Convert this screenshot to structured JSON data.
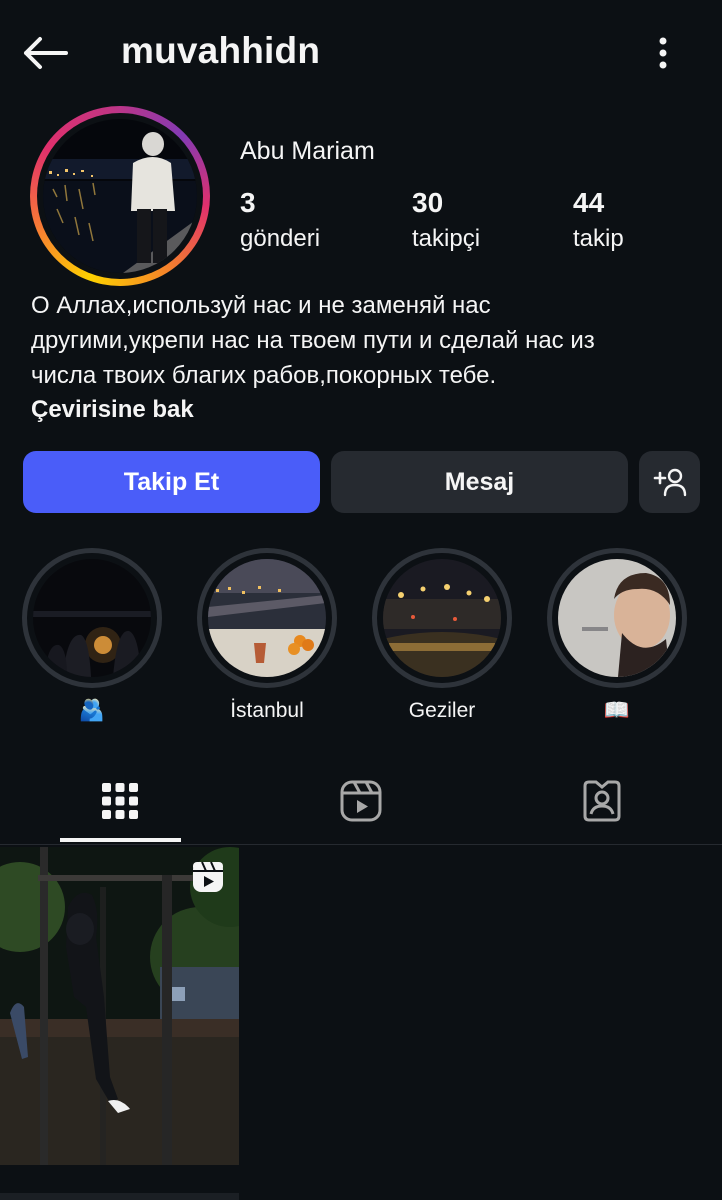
{
  "header": {
    "username": "muvahhidn",
    "back_icon": "arrow-left-icon",
    "more_icon": "more-vertical-icon"
  },
  "profile": {
    "display_name": "Abu Mariam",
    "stats": [
      {
        "value": "3",
        "label": "gönderi"
      },
      {
        "value": "30",
        "label": "takipçi"
      },
      {
        "value": "44",
        "label": "takip"
      }
    ],
    "bio_lines": [
      "О Аллах,используй нас и не заменяй нас",
      "другими,укрепи нас на твоем пути и сделай нас из",
      "числа твоих благих рабов,покорных тебе."
    ],
    "translate_label": "Çevirisine bak"
  },
  "actions": {
    "follow_label": "Takip Et",
    "message_label": "Mesaj",
    "suggest_icon": "add-person-icon"
  },
  "highlights": [
    {
      "label": "🫂"
    },
    {
      "label": "İstanbul"
    },
    {
      "label": "Geziler"
    },
    {
      "label": "📖"
    }
  ],
  "tabs": {
    "active": "grid",
    "items": [
      "grid-icon",
      "reels-icon",
      "tagged-icon"
    ]
  },
  "colors": {
    "background": "#0c1014",
    "follow_button": "#4a5df9",
    "secondary_button": "#262a30",
    "text": "#f5f5f5"
  }
}
